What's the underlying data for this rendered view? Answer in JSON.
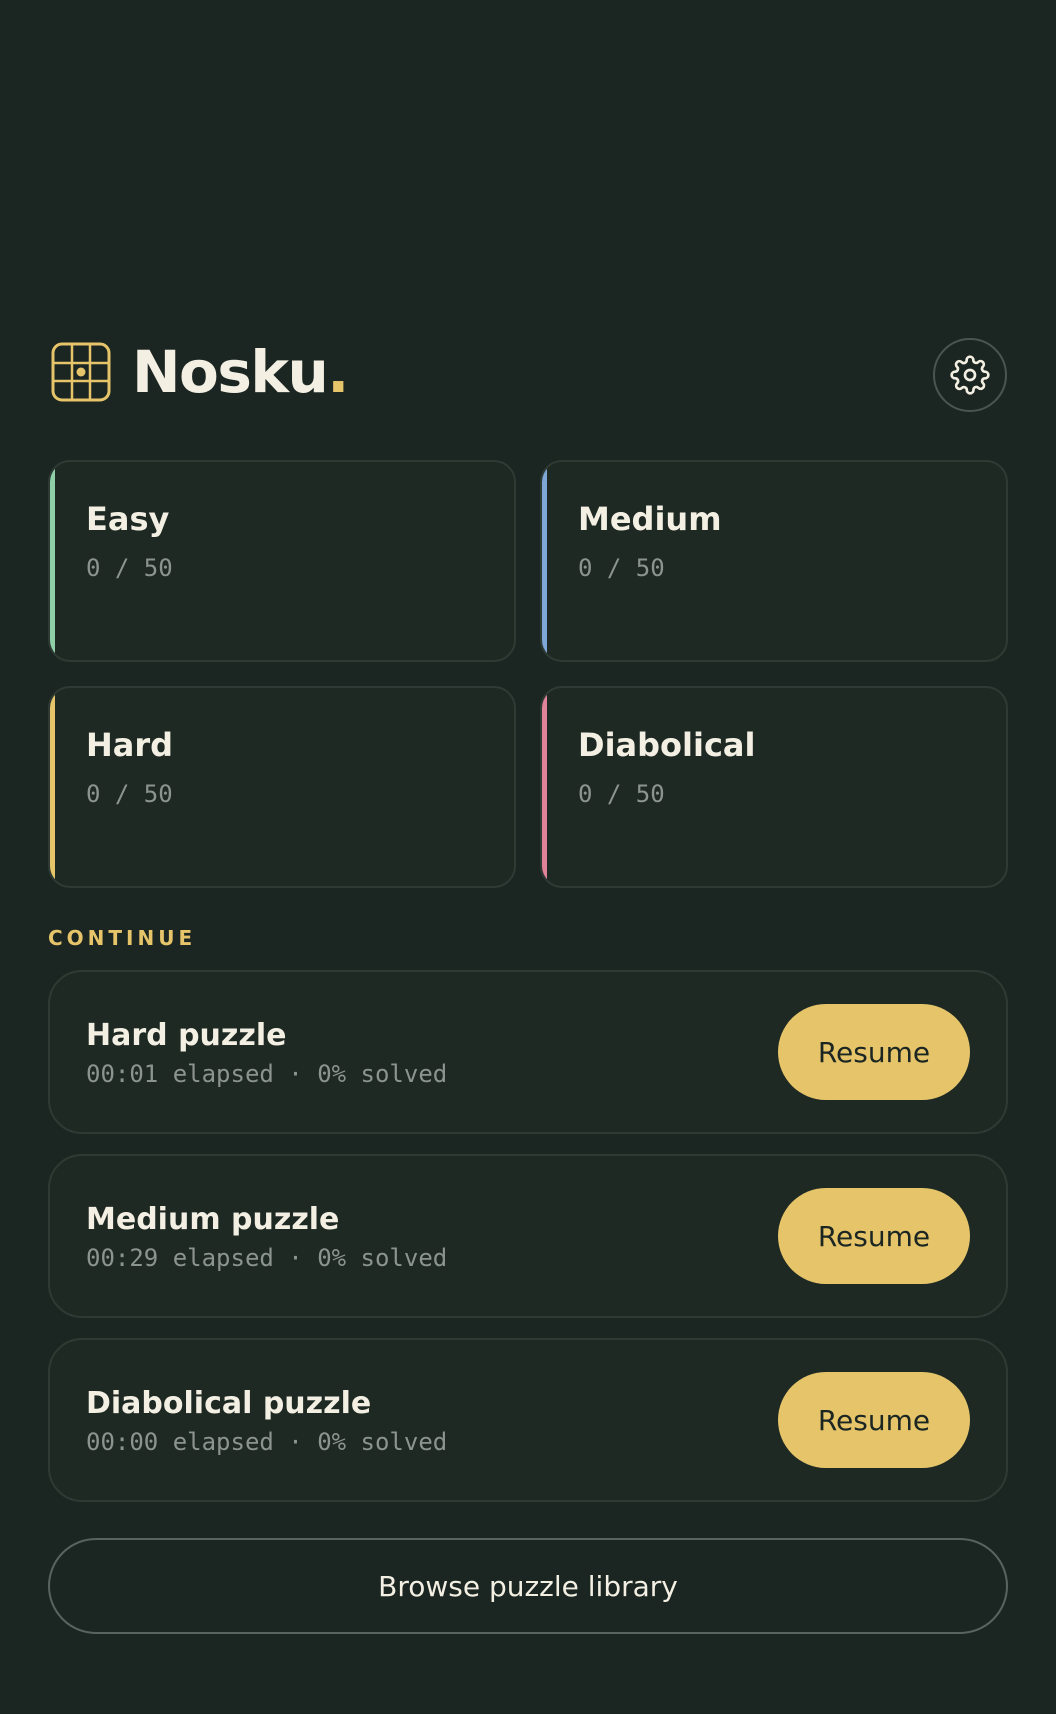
{
  "brand": {
    "name": "Nosku",
    "dot": ".",
    "logo_icon": "grid-logo-icon",
    "accent": "#e6c46a"
  },
  "header": {
    "settings_icon": "gear-icon"
  },
  "difficulties": [
    {
      "label": "Easy",
      "count": "0 / 50",
      "accent": "#8fcfa8"
    },
    {
      "label": "Medium",
      "count": "0 / 50",
      "accent": "#7ea6d6"
    },
    {
      "label": "Hard",
      "count": "0 / 50",
      "accent": "#e6c46a"
    },
    {
      "label": "Diabolical",
      "count": "0 / 50",
      "accent": "#e0839a"
    }
  ],
  "continue": {
    "label": "CONTINUE",
    "items": [
      {
        "title": "Hard puzzle",
        "meta": "00:01 elapsed · 0% solved",
        "button": "Resume"
      },
      {
        "title": "Medium puzzle",
        "meta": "00:29 elapsed · 0% solved",
        "button": "Resume"
      },
      {
        "title": "Diabolical puzzle",
        "meta": "00:00 elapsed · 0% solved",
        "button": "Resume"
      }
    ]
  },
  "browse": {
    "label": "Browse puzzle library"
  },
  "colors": {
    "background": "#1b2521",
    "card": "#1e2924",
    "accent": "#e6c46a"
  }
}
